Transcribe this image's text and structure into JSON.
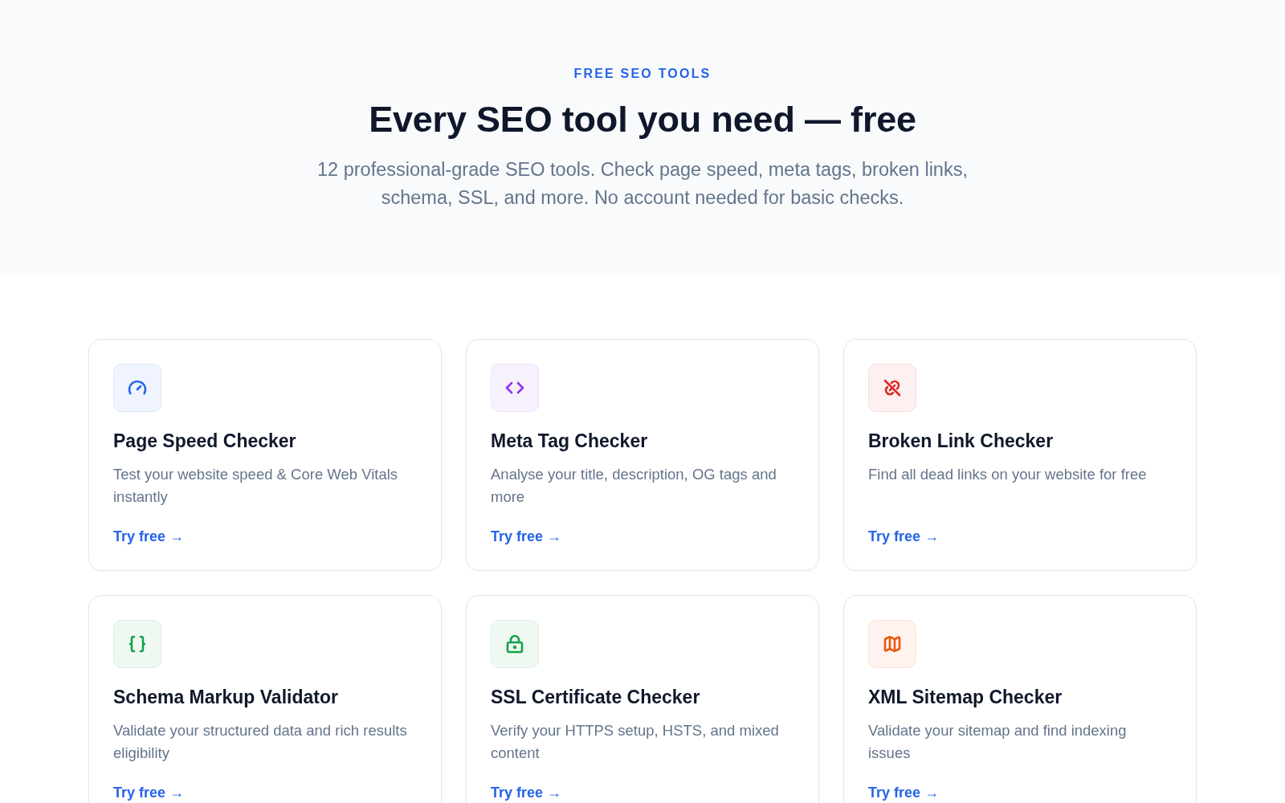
{
  "header": {
    "eyebrow": "FREE SEO TOOLS",
    "title": "Every SEO tool you need — free",
    "subtitle": "12 professional-grade SEO tools. Check page speed, meta tags, broken links, schema, SSL, and more. No account needed for basic checks."
  },
  "tools": [
    {
      "name": "Page Speed Checker",
      "description": "Test your website speed & Core Web Vitals instantly",
      "link": "Try free →",
      "color": "#2563eb"
    },
    {
      "name": "Meta Tag Checker",
      "description": "Analyse your title, description, OG tags and more",
      "link": "Try free →",
      "color": "#9333ea"
    },
    {
      "name": "Broken Link Checker",
      "description": "Find all dead links on your website for free",
      "link": "Try free →",
      "color": "#dc2626"
    },
    {
      "name": "Schema Markup Validator",
      "description": "Validate your structured data and rich results eligibility",
      "link": "Try free →",
      "color": "#16a34a"
    },
    {
      "name": "SSL Certificate Checker",
      "description": "Verify your HTTPS setup, HSTS, and mixed content",
      "link": "Try free →",
      "color": "#16a34a"
    },
    {
      "name": "XML Sitemap Checker",
      "description": "Validate your sitemap and find indexing issues",
      "link": "Try free →",
      "color": "#ea580c"
    }
  ]
}
